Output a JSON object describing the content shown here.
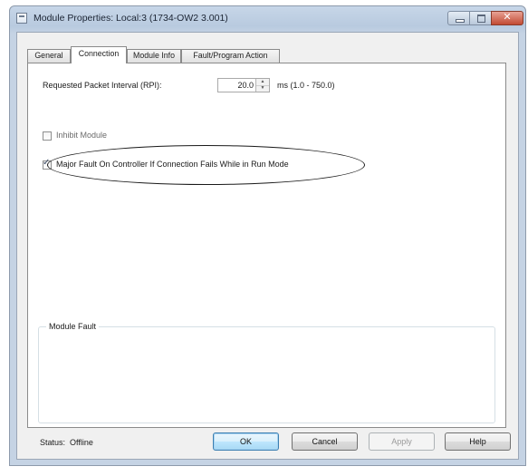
{
  "window": {
    "title": "Module Properties: Local:3 (1734-OW2 3.001)",
    "controls": {
      "minimize_icon": "minimize-icon",
      "maximize_icon": "maximize-icon",
      "close_icon": "close-icon",
      "close_glyph": "✕"
    }
  },
  "tabs": [
    {
      "label": "General",
      "active": false
    },
    {
      "label": "Connection",
      "active": true
    },
    {
      "label": "Module Info",
      "active": false
    },
    {
      "label": "Fault/Program Action",
      "active": false
    }
  ],
  "connection": {
    "rpi_label": "Requested Packet Interval (RPI):",
    "rpi_value": "20.0",
    "rpi_range": "ms (1.0 - 750.0)",
    "inhibit_label": "Inhibit Module",
    "inhibit_checked": false,
    "major_fault_label": "Major Fault On Controller If Connection Fails While in Run Mode",
    "major_fault_checked": true,
    "check_glyph": "✓",
    "module_fault_title": "Module Fault"
  },
  "footer": {
    "status_label": "Status:",
    "status_value": "Offline",
    "buttons": {
      "ok": "OK",
      "cancel": "Cancel",
      "apply": "Apply",
      "help": "Help"
    }
  },
  "colors": {
    "title_bar": "#c5d3e4",
    "close_button": "#c24a32",
    "default_button": "#a7d9f5",
    "annotation_ellipse": "#1a1a1a"
  }
}
